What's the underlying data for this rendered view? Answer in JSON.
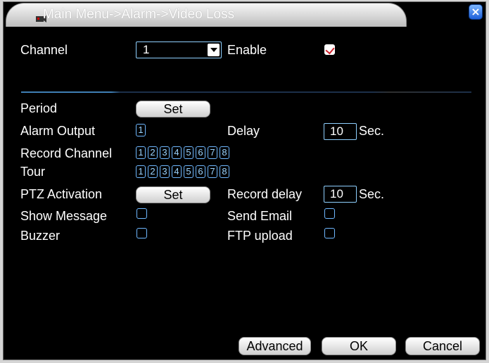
{
  "window": {
    "title": "Main Menu->Alarm->Video Loss",
    "close_label": "×"
  },
  "channel": {
    "label": "Channel",
    "value": "1"
  },
  "enable": {
    "label": "Enable",
    "checked": true
  },
  "period": {
    "label": "Period",
    "button": "Set"
  },
  "alarm_output": {
    "label": "Alarm Output",
    "boxes": [
      "1"
    ]
  },
  "delay": {
    "label": "Delay",
    "value": "10",
    "unit": "Sec."
  },
  "record_channel": {
    "label": "Record Channel",
    "boxes": [
      "1",
      "2",
      "3",
      "4",
      "5",
      "6",
      "7",
      "8"
    ]
  },
  "tour": {
    "label": "Tour",
    "boxes": [
      "1",
      "2",
      "3",
      "4",
      "5",
      "6",
      "7",
      "8"
    ]
  },
  "ptz": {
    "label": "PTZ Activation",
    "button": "Set"
  },
  "record_delay": {
    "label": "Record delay",
    "value": "10",
    "unit": "Sec."
  },
  "show_message": {
    "label": "Show Message",
    "checked": false
  },
  "send_email": {
    "label": "Send Email",
    "checked": false
  },
  "buzzer": {
    "label": "Buzzer",
    "checked": false
  },
  "ftp_upload": {
    "label": "FTP upload",
    "checked": false
  },
  "buttons": {
    "advanced": "Advanced",
    "ok": "OK",
    "cancel": "Cancel"
  },
  "colors": {
    "background": "#000000",
    "accent": "#6fb8ff",
    "check": "#d0202a",
    "close": "#1d5fd8"
  }
}
